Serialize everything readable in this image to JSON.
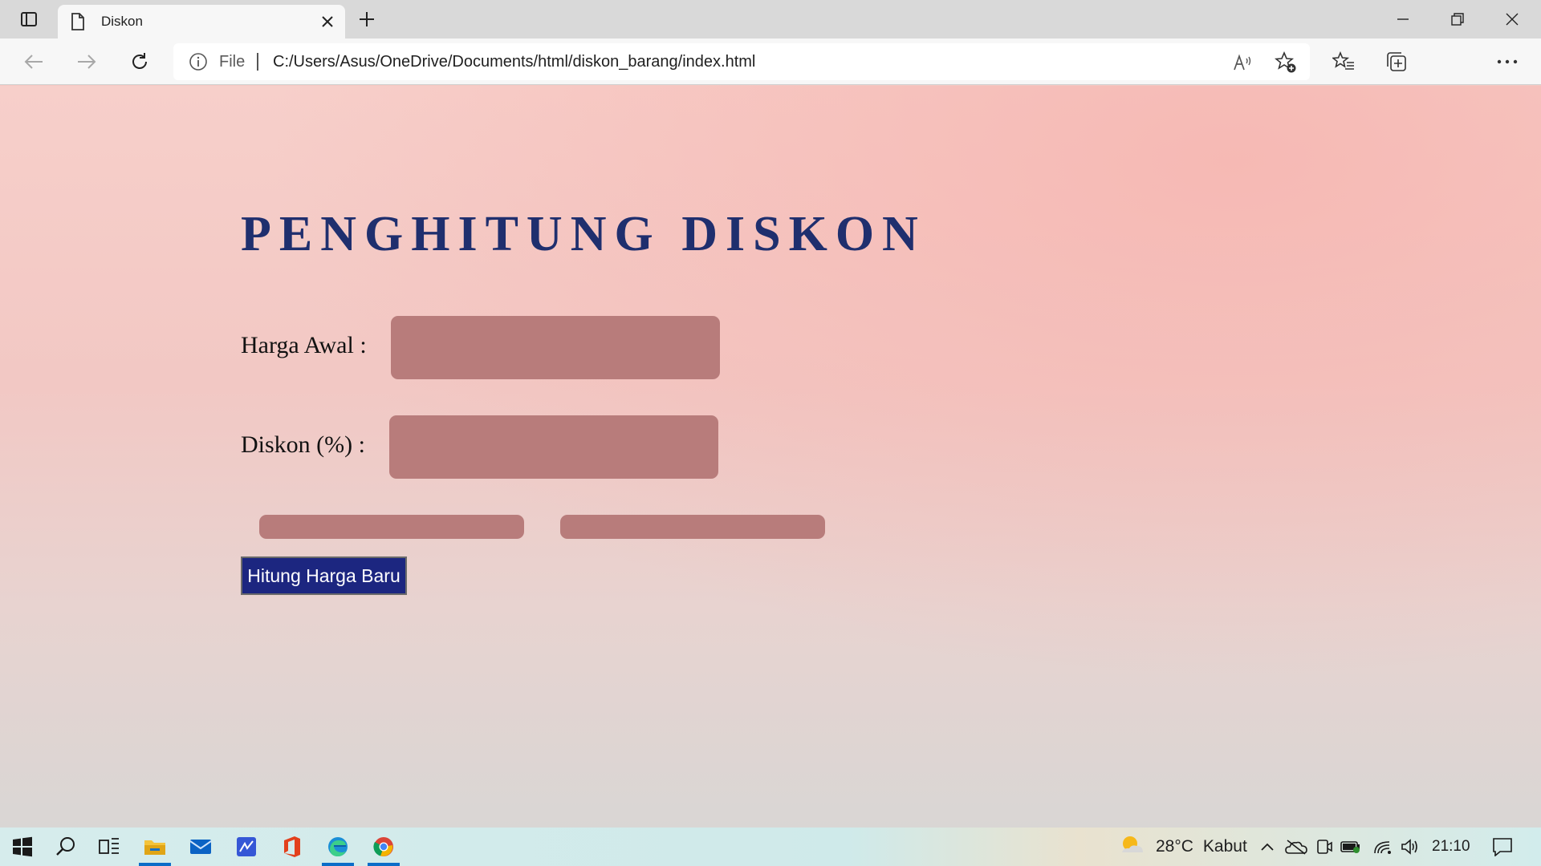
{
  "browser": {
    "tab_title": "Diskon",
    "address_scheme_label": "File",
    "address_url": "C:/Users/Asus/OneDrive/Documents/html/diskon_barang/index.html",
    "icons": [
      "tab-actions-icon",
      "page-icon",
      "close-icon",
      "plus-icon",
      "minimize-icon",
      "restore-icon",
      "close-window-icon",
      "back-icon",
      "forward-icon",
      "refresh-icon",
      "info-icon",
      "read-aloud-icon",
      "add-favorite-icon",
      "favorites-icon",
      "collections-icon",
      "profile-icon",
      "more-icon"
    ]
  },
  "page": {
    "heading": "PENGHITUNG DISKON",
    "harga_awal_label": "Harga Awal :",
    "harga_awal_value": "",
    "diskon_label": "Diskon (%) :",
    "diskon_value": "",
    "button_label": "Hitung Harga Baru",
    "colors": {
      "heading": "#1f2f6e",
      "input_bg": "#b87c7b",
      "button_bg": "#1c2680"
    }
  },
  "taskbar": {
    "apps": [
      "start-icon",
      "search-icon",
      "task-view-icon",
      "file-explorer-icon",
      "mail-icon",
      "whiteboard-icon",
      "office-icon",
      "edge-icon",
      "chrome-icon"
    ],
    "weather_temp": "28°C",
    "weather_desc": "Kabut",
    "clock": "21:10"
  }
}
